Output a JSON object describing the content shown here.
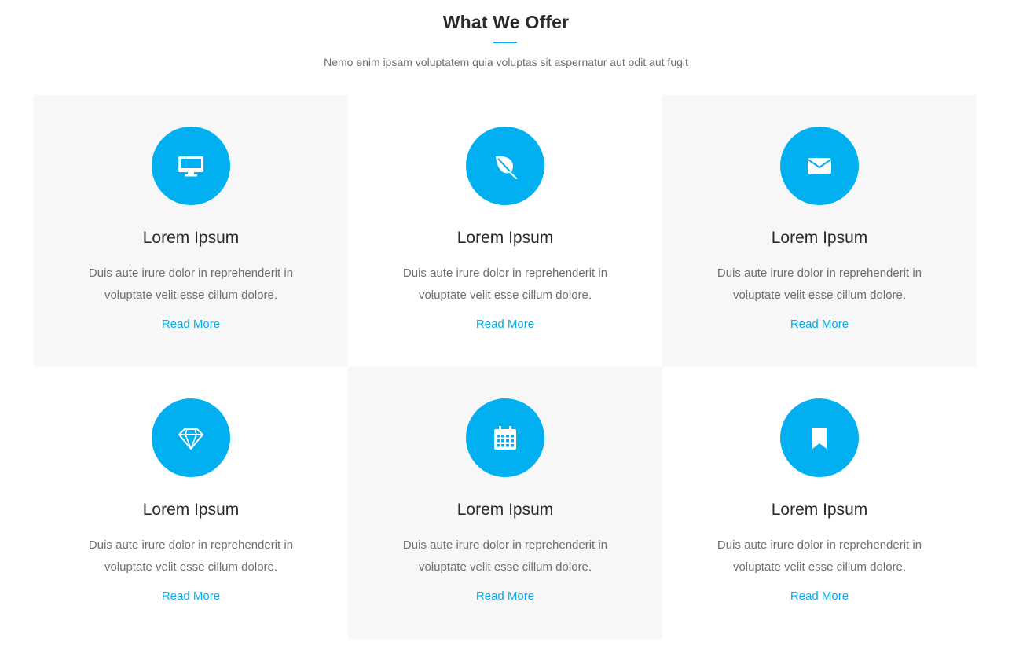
{
  "section": {
    "title": "What We Offer",
    "subtitle": "Nemo enim ipsam voluptatem quia voluptas sit aspernatur aut odit aut fugit"
  },
  "colors": {
    "accent": "#00b0f0",
    "card_shaded": "#f7f7f7",
    "title_text": "#2b2b2b",
    "body_text": "#6f6f6f"
  },
  "services": [
    {
      "icon": "desktop-icon",
      "title": "Lorem Ipsum",
      "text": "Duis aute irure dolor in reprehenderit in voluptate velit esse cillum dolore.",
      "link": "Read More"
    },
    {
      "icon": "leaf-icon",
      "title": "Lorem Ipsum",
      "text": "Duis aute irure dolor in reprehenderit in voluptate velit esse cillum dolore.",
      "link": "Read More"
    },
    {
      "icon": "envelope-icon",
      "title": "Lorem Ipsum",
      "text": "Duis aute irure dolor in reprehenderit in voluptate velit esse cillum dolore.",
      "link": "Read More"
    },
    {
      "icon": "diamond-icon",
      "title": "Lorem Ipsum",
      "text": "Duis aute irure dolor in reprehenderit in voluptate velit esse cillum dolore.",
      "link": "Read More"
    },
    {
      "icon": "calendar-icon",
      "title": "Lorem Ipsum",
      "text": "Duis aute irure dolor in reprehenderit in voluptate velit esse cillum dolore.",
      "link": "Read More"
    },
    {
      "icon": "bookmark-icon",
      "title": "Lorem Ipsum",
      "text": "Duis aute irure dolor in reprehenderit in voluptate velit esse cillum dolore.",
      "link": "Read More"
    }
  ]
}
